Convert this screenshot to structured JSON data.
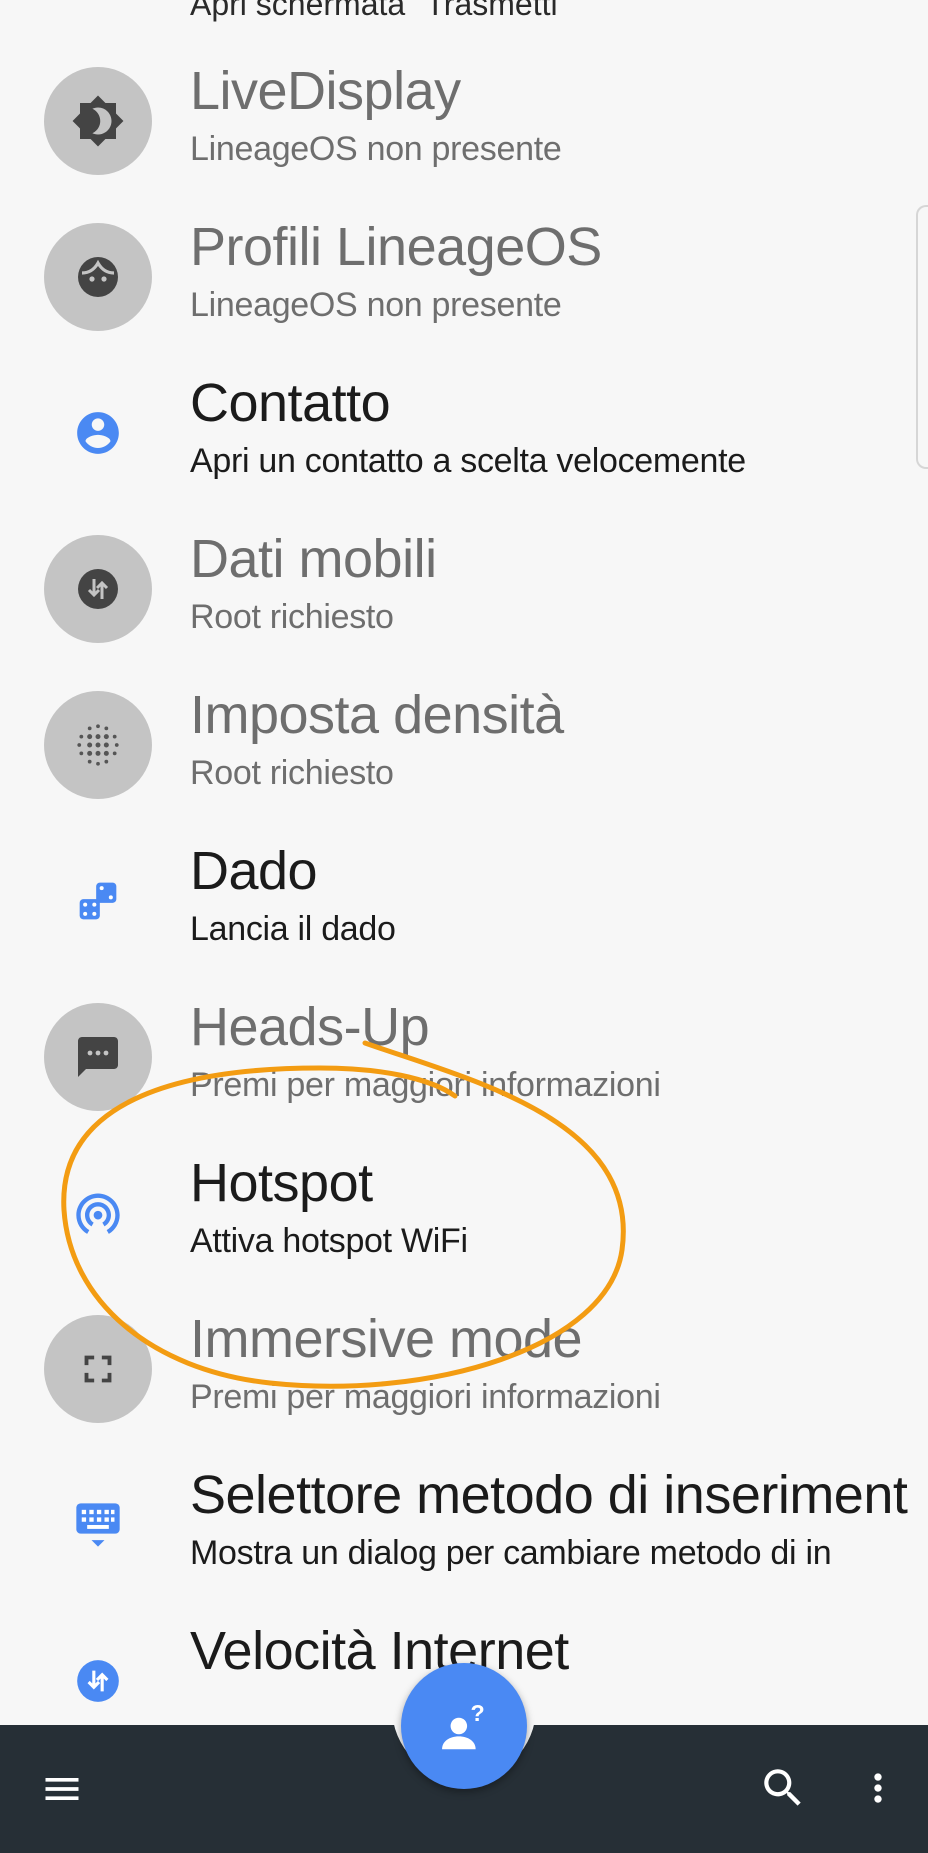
{
  "partial_item": {
    "subtitle": "Apri schermata \"Trasmetti\""
  },
  "items": [
    {
      "title": "LiveDisplay",
      "subtitle": "LineageOS non presente",
      "icon": "brightness-icon",
      "enabled": false
    },
    {
      "title": "Profili LineageOS",
      "subtitle": "LineageOS non presente",
      "icon": "face-icon",
      "enabled": false
    },
    {
      "title": "Contatto",
      "subtitle": "Apri un contatto a scelta velocemente",
      "icon": "account-circle-icon",
      "enabled": true
    },
    {
      "title": "Dati mobili",
      "subtitle": "Root richiesto",
      "icon": "mobile-data-icon",
      "enabled": false
    },
    {
      "title": "Imposta densità",
      "subtitle": "Root richiesto",
      "icon": "density-dots-icon",
      "enabled": false
    },
    {
      "title": "Dado",
      "subtitle": "Lancia il dado",
      "icon": "dice-icon",
      "enabled": true
    },
    {
      "title": "Heads-Up",
      "subtitle": "Premi per maggiori informazioni",
      "icon": "message-icon",
      "enabled": false
    },
    {
      "title": "Hotspot",
      "subtitle": "Attiva hotspot WiFi",
      "icon": "hotspot-icon",
      "enabled": true
    },
    {
      "title": "Immersive mode",
      "subtitle": "Premi per maggiori informazioni",
      "icon": "fullscreen-icon",
      "enabled": false
    },
    {
      "title": "Selettore metodo di inseriment",
      "subtitle": "Mostra un dialog per cambiare metodo di in",
      "icon": "keyboard-icon",
      "enabled": true
    },
    {
      "title": "Velocità Internet",
      "subtitle": "",
      "icon": "data-speed-icon",
      "enabled": true
    }
  ],
  "bottom_bar": {
    "menu_icon": "menu-icon",
    "search_icon": "search-icon",
    "overflow_icon": "more-vert-icon",
    "fab_icon": "help-person-icon"
  },
  "colors": {
    "accent": "#4a89f3",
    "bar": "#262f36",
    "annotation": "#f39c12",
    "disabled_circle": "#c4c4c4"
  }
}
